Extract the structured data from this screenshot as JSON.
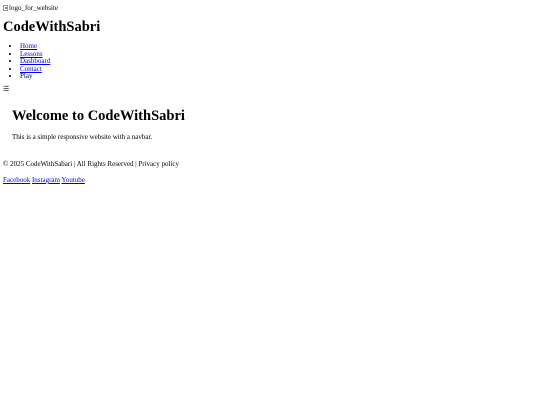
{
  "header": {
    "logo_alt": "logo_for_website",
    "site_title": "CodeWithSabri"
  },
  "nav": {
    "items": [
      {
        "label": "Home",
        "link": true
      },
      {
        "label": "Lessons",
        "link": true
      },
      {
        "label": "Dashboard",
        "link": true
      },
      {
        "label": "Contact",
        "link": true
      },
      {
        "label": "Play",
        "link": false
      }
    ],
    "menu_toggle": "☰"
  },
  "hero": {
    "title": "Welcome to CodeWithSabri",
    "text": "This is a simple responsive website with a navbar."
  },
  "footer": {
    "copyright": "© 2025 CodeWithSabari | All Rights Reserved | Privacy policy",
    "social": [
      "Facebook",
      "Instagram",
      "Youtube"
    ]
  },
  "colors": {
    "link": "#0000ee",
    "text": "#000000",
    "background": "#ffffff"
  }
}
